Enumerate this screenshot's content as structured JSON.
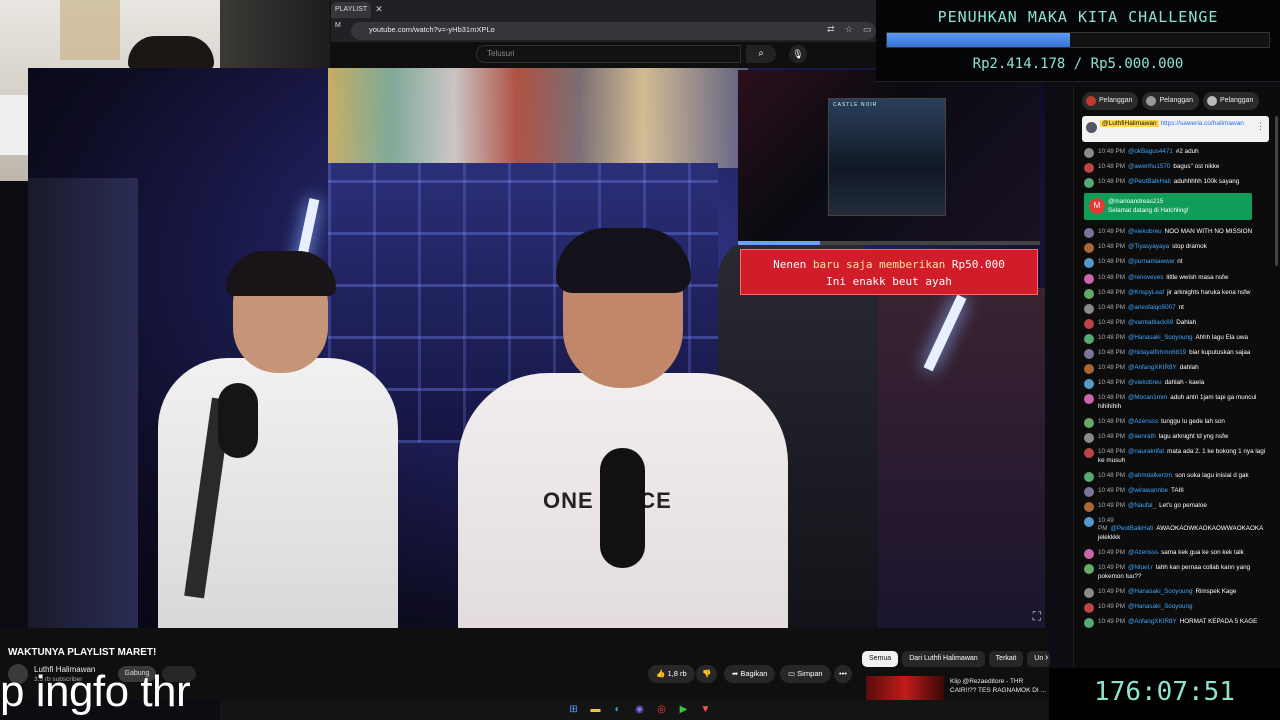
{
  "browser": {
    "tab_label": "PLAYLIST M",
    "url": "youtube.com/watch?v=-yHb31mXPLo",
    "search_placeholder": "Telusuri"
  },
  "challenge": {
    "title": "PENUHKAN MAKA KITA CHALLENGE",
    "progress_fraction": 0.48,
    "amount": "Rp2.414.178 / Rp5.000.000"
  },
  "alert": {
    "name": "Nenen",
    "mid": "baru saja memberikan",
    "amount": "Rp50.000",
    "message": "Ini enakk beut ayah"
  },
  "thumb": {
    "art_text": "CASTLE NOIR",
    "progress_fraction": 0.27
  },
  "video_overlay": {
    "shirt_text": "ONE PIECE"
  },
  "chat": {
    "tabs": [
      "Pelanggan",
      "Pelanggan",
      "Pelanggan"
    ],
    "pinned": {
      "name": "@LuthfiHalimawan",
      "link": "https://saweria.co/halimawan"
    },
    "messages_top": [
      {
        "time": "10:48 PM",
        "name": "@okBagus4471",
        "text": "#2  aduh"
      },
      {
        "time": "10:48 PM",
        "name": "@awenhu1570",
        "text": "bagus\" ost nikke"
      },
      {
        "time": "10:48 PM",
        "name": "@PeotBalkHati",
        "text": "aduhhhhh 100k sayang"
      }
    ],
    "welcome": {
      "initial": "M",
      "name": "@marioandreas215",
      "text": "Selamat datang di Hatchling!"
    },
    "messages": [
      {
        "time": "10:48 PM",
        "name": "@viekobreu",
        "text": "NOO MAN WITH NO MISSION"
      },
      {
        "time": "10:48 PM",
        "name": "@Tiyasyayaya",
        "text": "stop dramok"
      },
      {
        "time": "10:48 PM",
        "name": "@purnamiawww",
        "text": "nt"
      },
      {
        "time": "10:48 PM",
        "name": "@renoveves",
        "text": "little wwish masa nsfw"
      },
      {
        "time": "10:48 PM",
        "name": "@KrispyLeaf",
        "text": "jir arknights haruka kena nsfw"
      },
      {
        "time": "10:48 PM",
        "name": "@ariesfaiqo5007",
        "text": "nt"
      },
      {
        "time": "10:48 PM",
        "name": "@vamtablack69",
        "text": "Dahlah"
      },
      {
        "time": "10:48 PM",
        "name": "@Hanasaki_Sooyoung",
        "text": "Ahhh lagu Ela uwa"
      },
      {
        "time": "10:48 PM",
        "name": "@hidayatfirhmn6819",
        "text": "biar kuputuskan sajaa"
      },
      {
        "time": "10:48 PM",
        "name": "@AnfangXKIR8Y",
        "text": "dahlah"
      },
      {
        "time": "10:48 PM",
        "name": "@viekobreu",
        "text": "dahlah - kaela"
      },
      {
        "time": "10:48 PM",
        "name": "@Mocan1mm",
        "text": "aduh antri 1jam tapi ga muncul hihihihih"
      },
      {
        "time": "10:48 PM",
        "name": "@Azensss",
        "text": "tunggu lu gede lah son"
      },
      {
        "time": "10:48 PM",
        "name": "@aenrath",
        "text": "lagu arknight td yng nsfw"
      },
      {
        "time": "10:48 PM",
        "name": "@naurakrifat",
        "text": "mata ada 2. 1 ke bokong 1 nya lagi ke musuh"
      },
      {
        "time": "10:48 PM",
        "name": "@ahmdalkerzm",
        "text": "son suka lagu inisial d gak"
      },
      {
        "time": "10:49 PM",
        "name": "@wirawannbe",
        "text": "TAIII"
      },
      {
        "time": "10:49 PM",
        "name": "@Naufal_",
        "text": "Let's go pemaloe"
      },
      {
        "time": "10:49 PM",
        "name": "@PeotBalkHati",
        "text": "AWAOKAOWKAOKAOWWAOKAOKA jelekkkk"
      },
      {
        "time": "10:49 PM",
        "name": "@Azensss",
        "text": "sama kek gua ke son kek talk"
      },
      {
        "time": "10:49 PM",
        "name": "@Ntuel.r",
        "text": "lahh kan pernaa collab kann yang pokemon tuu??"
      },
      {
        "time": "10:49 PM",
        "name": "@Hanasaki_Sooyoung",
        "text": "Rimspek Kage"
      },
      {
        "time": "10:49 PM",
        "name": "@Hanasaki_Sooyoung",
        "text": ""
      },
      {
        "time": "10:49 PM",
        "name": "@AnfangXKIR8Y",
        "text": "HORMAT KEPADA 5 KAGE"
      }
    ]
  },
  "timer": "176:07:51",
  "video": {
    "title": "WAKTUNYA PLAYLIST MARET!",
    "channel": "Luthfi Halimawan",
    "subs": "3,5 rb subscriber",
    "join_label": "Gabung",
    "likes": "1,8 rb",
    "share_label": "Bagikan",
    "save_label": "Simpan",
    "more_label": "•••"
  },
  "chips": [
    "Semua",
    "Dari Luthfi Halimawan",
    "Terkait",
    "Un"
  ],
  "recommended": {
    "title": "Klip @Rezaeditore - THR CAIR!!?? TES RAGNAMOK DI ..."
  },
  "caption": "p ingfo thr",
  "colors": {
    "accent_teal": "#8ee3d0",
    "alert_red": "#d11c2a",
    "progress_blue": "#3573d8",
    "welcome_green": "#0f9d58"
  }
}
